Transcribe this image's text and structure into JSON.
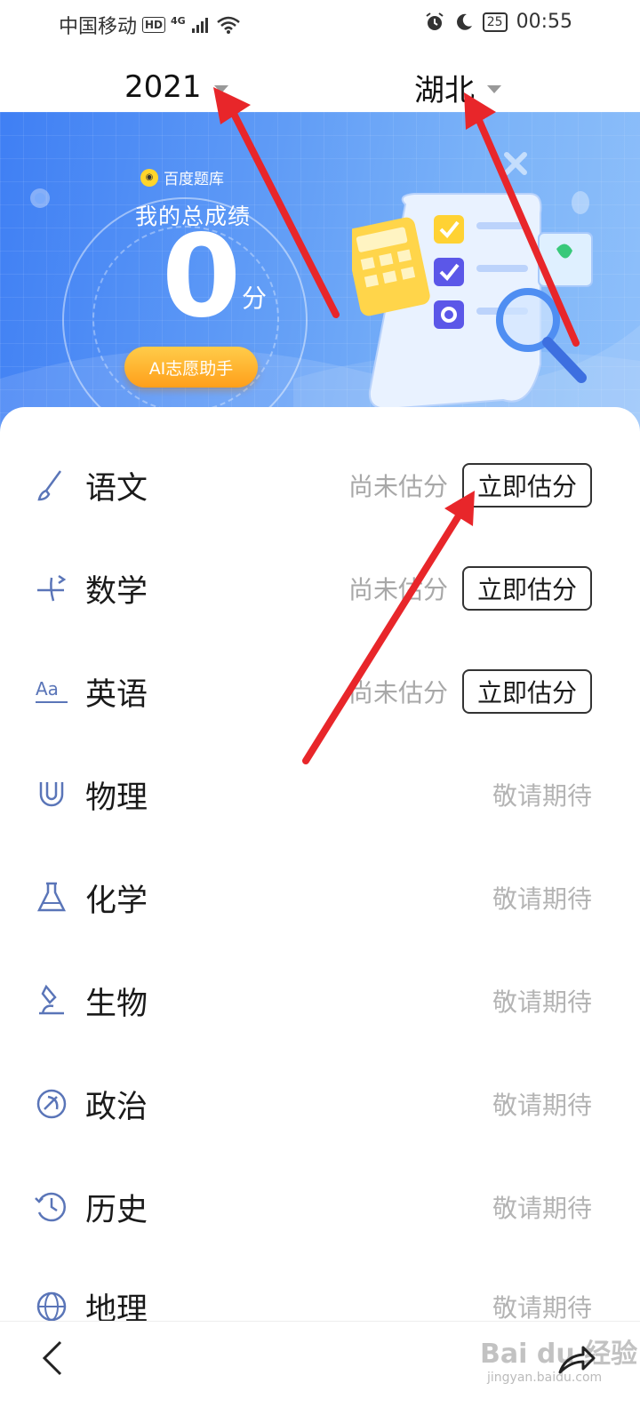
{
  "status_bar": {
    "carrier": "中国移动",
    "hd": "HD",
    "network": "4G",
    "battery": "25",
    "time": "00:55"
  },
  "selectors": {
    "year": "2021",
    "province": "湖北"
  },
  "banner": {
    "brand": "百度题库",
    "total_label": "我的总成绩",
    "score": "0",
    "unit": "分",
    "ai_button": "AI志愿助手"
  },
  "subjects": [
    {
      "name": "语文",
      "status": "尚未估分",
      "action": "立即估分",
      "icon": "brush-icon"
    },
    {
      "name": "数学",
      "status": "尚未估分",
      "action": "立即估分",
      "icon": "math-icon"
    },
    {
      "name": "英语",
      "status": "尚未估分",
      "action": "立即估分",
      "icon": "aa-letters-icon"
    },
    {
      "name": "物理",
      "status": "敬请期待",
      "icon": "magnet-icon"
    },
    {
      "name": "化学",
      "status": "敬请期待",
      "icon": "flask-icon"
    },
    {
      "name": "生物",
      "status": "敬请期待",
      "icon": "microscope-icon"
    },
    {
      "name": "政治",
      "status": "敬请期待",
      "icon": "emblem-icon"
    },
    {
      "name": "历史",
      "status": "敬请期待",
      "icon": "history-clock-icon"
    },
    {
      "name": "地理",
      "status": "敬请期待",
      "icon": "globe-icon"
    }
  ],
  "watermark": {
    "text": "Bai du 经验",
    "sub": "jingyan.baidu.com"
  },
  "annotation_color": "#e8262a",
  "accent_blue": "#4a86f5"
}
